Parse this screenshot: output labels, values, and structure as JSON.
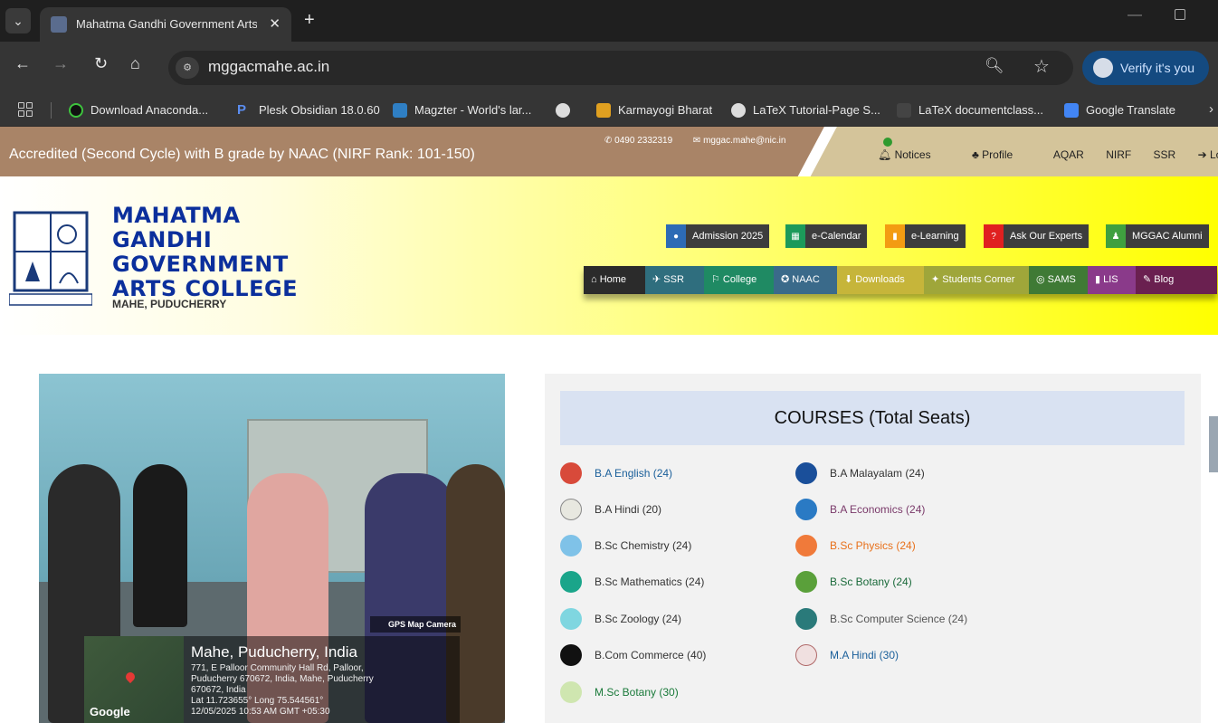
{
  "browser": {
    "tab_title": "Mahatma Gandhi Government Arts",
    "url": "mggacmahe.ac.in",
    "verify_label": "Verify it's you",
    "bookmarks": [
      {
        "label": "Download Anaconda...",
        "color": "#111111"
      },
      {
        "label": "Plesk Obsidian 18.0.60",
        "color": "#3b6fd8"
      },
      {
        "label": "Magzter - World's lar...",
        "color": "#2f7fc4"
      },
      {
        "label": "",
        "color": "#dddddd"
      },
      {
        "label": "Karmayogi Bharat",
        "color": "#e0a020"
      },
      {
        "label": "LaTeX Tutorial-Page S...",
        "color": "#dddddd"
      },
      {
        "label": "LaTeX documentclass...",
        "color": "#444444"
      },
      {
        "label": "Google Translate",
        "color": "#4285f4"
      }
    ]
  },
  "topbar": {
    "accreditation": "Accredited (Second Cycle) with B grade by NAAC    (NIRF Rank: 101-150)",
    "phone": "0490 2332319",
    "email": "mggac.mahe@nic.in",
    "links": [
      "Notices",
      "Profile",
      "AQAR",
      "NIRF",
      "SSR",
      "Login"
    ]
  },
  "header": {
    "title": "MAHATMA GANDHI GOVERNMENT ARTS COLLEGE",
    "subtitle": "MAHE, PUDUCHERRY",
    "quick_links": [
      {
        "label": "Admission 2025",
        "color": "#2d6bb5"
      },
      {
        "label": "e-Calendar",
        "color": "#1c9a5a"
      },
      {
        "label": "e-Learning",
        "color": "#f39c12"
      },
      {
        "label": "Ask Our Experts",
        "color": "#e02020"
      },
      {
        "label": "MGGAC Alumni",
        "color": "#3fa03f"
      }
    ],
    "nav": [
      {
        "label": "Home",
        "color": "#2b2b2b"
      },
      {
        "label": "SSR",
        "color": "#2f6e7e"
      },
      {
        "label": "College",
        "color": "#1f8a63"
      },
      {
        "label": "NAAC",
        "color": "#3a6a8a"
      },
      {
        "label": "Downloads",
        "color": "#c6b53a"
      },
      {
        "label": "Students Corner",
        "color": "#9fa63a"
      },
      {
        "label": "SAMS",
        "color": "#3f7a35"
      },
      {
        "label": "LIS",
        "color": "#8a3a8a"
      },
      {
        "label": "Blog",
        "color": "#6a2050"
      }
    ]
  },
  "photo": {
    "gps_badge": "GPS Map Camera",
    "place": "Mahe, Puducherry, India",
    "address_1": "771, E Palloor Community Hall Rd, Palloor,",
    "address_2": "Puducherry 670672, India, Mahe, Puducherry",
    "address_3": "670672, India",
    "coords": "Lat 11.723655° Long 75.544561°",
    "timestamp": "12/05/2025 10:53 AM GMT +05:30",
    "map_brand": "Google"
  },
  "courses": {
    "heading": "COURSES (Total Seats)",
    "left": [
      {
        "label": "B.A English (24)",
        "color": "#1a5f9a",
        "icon": "#d84a3a"
      },
      {
        "label": "B.A Hindi (20)",
        "color": "#333333",
        "icon": "#e8e8e0"
      },
      {
        "label": "B.Sc Chemistry (24)",
        "color": "#333333",
        "icon": "#7fc2e8"
      },
      {
        "label": "B.Sc Mathematics (24)",
        "color": "#333333",
        "icon": "#1aa58a"
      },
      {
        "label": "B.Sc Zoology (24)",
        "color": "#333333",
        "icon": "#7fd6e0"
      },
      {
        "label": "B.Com Commerce (40)",
        "color": "#333333",
        "icon": "#111111"
      },
      {
        "label": "M.Sc Botany (30)",
        "color": "#1a7a3a",
        "icon": "#cfe6b0"
      }
    ],
    "right": [
      {
        "label": "B.A Malayalam (24)",
        "color": "#333333",
        "icon": "#1a4f9a"
      },
      {
        "label": "B.A Economics (24)",
        "color": "#7a3a6a",
        "icon": "#2a7ac4"
      },
      {
        "label": "B.Sc Physics (24)",
        "color": "#e8701a",
        "icon": "#f07a3a"
      },
      {
        "label": "B.Sc Botany (24)",
        "color": "#1a6a3a",
        "icon": "#5aa03a"
      },
      {
        "label": "B.Sc Computer Science (24)",
        "color": "#555555",
        "icon": "#2a7a7a"
      },
      {
        "label": "M.A Hindi (30)",
        "color": "#1a5f9a",
        "icon": "#f0e0e0"
      }
    ]
  }
}
